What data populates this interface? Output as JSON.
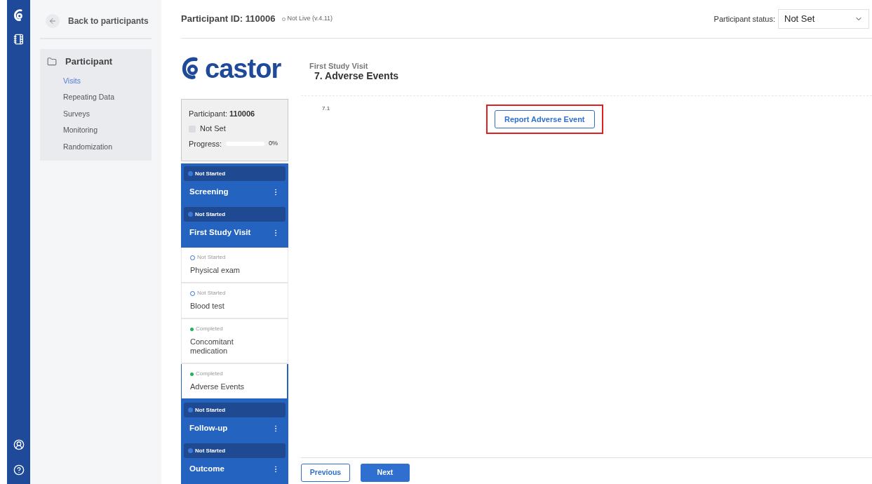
{
  "header": {
    "participant_id": "Participant ID: 110006",
    "version": "Not Live (v.4.11)",
    "status_label": "Participant status:",
    "status_value": "Not Set"
  },
  "sidebar": {
    "back": "Back to participants",
    "section": "Participant",
    "items": [
      {
        "label": "Visits",
        "selected": true
      },
      {
        "label": "Repeating Data",
        "selected": false
      },
      {
        "label": "Surveys",
        "selected": false
      },
      {
        "label": "Monitoring",
        "selected": false
      },
      {
        "label": "Randomization",
        "selected": false
      }
    ]
  },
  "logo": {
    "text": "castor"
  },
  "card": {
    "participant_label": "Participant:",
    "participant_value": "110006",
    "status": "Not Set",
    "progress_label": "Progress:",
    "level": 0,
    "reading": "0%"
  },
  "visits": [
    {
      "status": "Not Started",
      "kind": "not_started",
      "name": "Screening"
    },
    {
      "status": "Not Started",
      "kind": "not_started",
      "name": "First Study Visit",
      "steps": [
        {
          "status": "Not Started",
          "kind": "not_started",
          "name": "Physical exam",
          "selected": false
        },
        {
          "status": "Not Started",
          "kind": "not_started",
          "name": "Blood test",
          "selected": false
        },
        {
          "status": "Completed",
          "kind": "completed",
          "name": "Concomitant medication",
          "selected": false
        },
        {
          "status": "Completed",
          "kind": "completed",
          "name": "Adverse Events",
          "selected": true
        }
      ]
    },
    {
      "status": "Not Started",
      "kind": "not_started",
      "name": "Follow-up"
    },
    {
      "status": "Not Started",
      "kind": "not_started",
      "name": "Outcome"
    }
  ],
  "content": {
    "visit": "First Study Visit",
    "form_title": "7. Adverse Events",
    "field_number": "7.1",
    "action_button": "Report Adverse Event",
    "highlighted": true
  },
  "footer": {
    "buttons": [
      "Previous",
      "Next"
    ]
  }
}
